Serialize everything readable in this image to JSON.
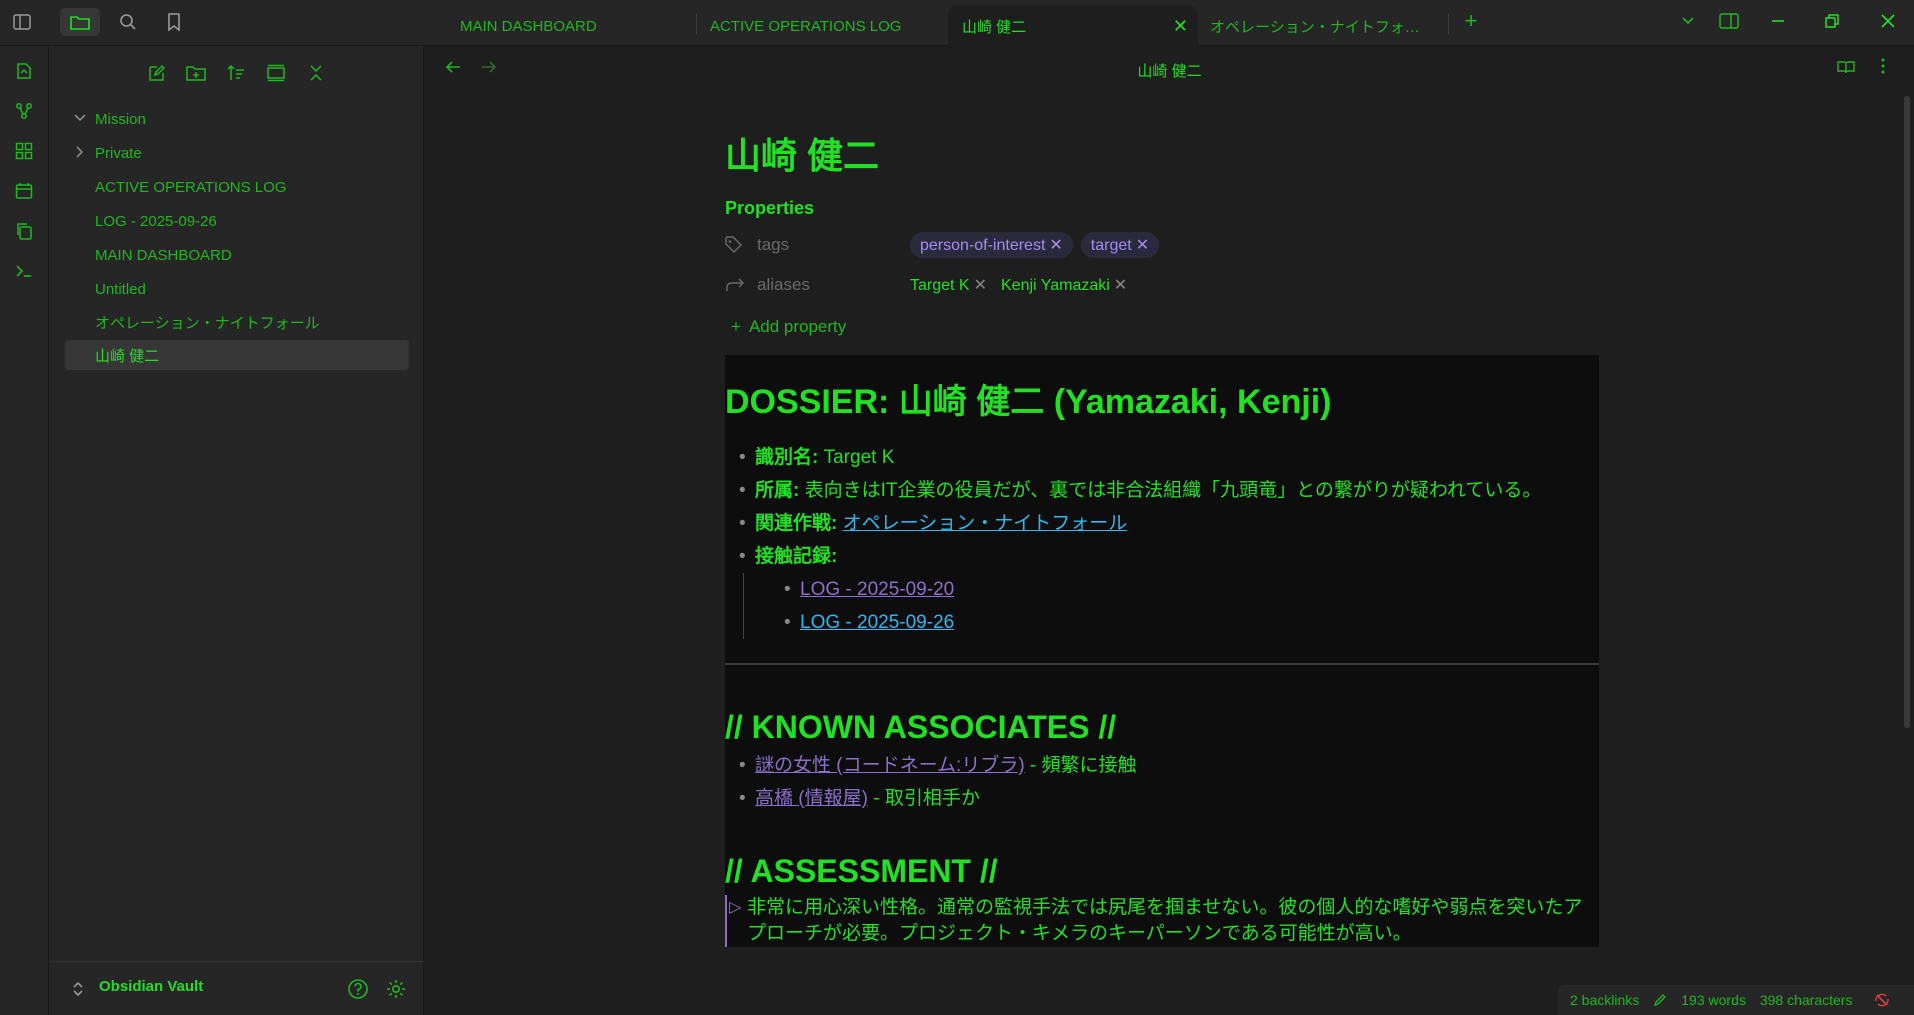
{
  "tabs": [
    {
      "label": "MAIN DASHBOARD"
    },
    {
      "label": "ACTIVE OPERATIONS LOG"
    },
    {
      "label": "山崎 健二"
    },
    {
      "label": "オペレーション・ナイトフォ…"
    }
  ],
  "sidebar": {
    "items": [
      {
        "label": "Mission"
      },
      {
        "label": "Private"
      },
      {
        "label": "ACTIVE OPERATIONS LOG"
      },
      {
        "label": "LOG - 2025-09-26"
      },
      {
        "label": "MAIN DASHBOARD"
      },
      {
        "label": "Untitled"
      },
      {
        "label": "オペレーション・ナイトフォール"
      },
      {
        "label": "山崎 健二"
      }
    ],
    "vault_name": "Obsidian Vault"
  },
  "view": {
    "header_title": "山崎 健二"
  },
  "note": {
    "title": "山崎 健二",
    "properties_heading": "Properties",
    "props": {
      "tags_key": "tags",
      "tags": [
        "person-of-interest",
        "target"
      ],
      "aliases_key": "aliases",
      "aliases": [
        "Target K",
        "Kenji Yamazaki"
      ],
      "add_label": "Add property"
    },
    "dossier_heading": "DOSSIER: 山崎 健二 (Yamazaki, Kenji)",
    "fields": {
      "id_label": "識別名:",
      "id_value": " Target K",
      "affil_label": "所属:",
      "affil_value": " 表向きはIT企業の役員だが、裏では非合法組織「九頭竜」との繋がりが疑われている。",
      "op_label": "関連作戦:",
      "op_link": "オペレーション・ナイトフォール",
      "contact_label": "接触記録:",
      "logs": [
        "LOG - 2025-09-20",
        "LOG - 2025-09-26"
      ]
    },
    "associates_heading": "// KNOWN ASSOCIATES //",
    "associates": [
      {
        "link": "謎の女性 (コードネーム:リブラ)",
        "desc": " - 頻繁に接触"
      },
      {
        "link": "高橋 (情報屋)",
        "desc": " - 取引相手か"
      }
    ],
    "assessment_heading": "// ASSESSMENT //",
    "assessment_text": "非常に用心深い性格。通常の監視手法では尻尾を掴ませない。彼の個人的な嗜好や弱点を突いたアプローチが必要。プロジェクト・キメラのキーパーソンである可能性が高い。"
  },
  "status": {
    "backlinks": "2 backlinks",
    "words": "193 words",
    "characters": "398 characters"
  },
  "colors": {
    "accent": "#22e024",
    "link": "#2fb7f0",
    "unresolved": "#8b70c9",
    "tag": "#a48cf2"
  }
}
